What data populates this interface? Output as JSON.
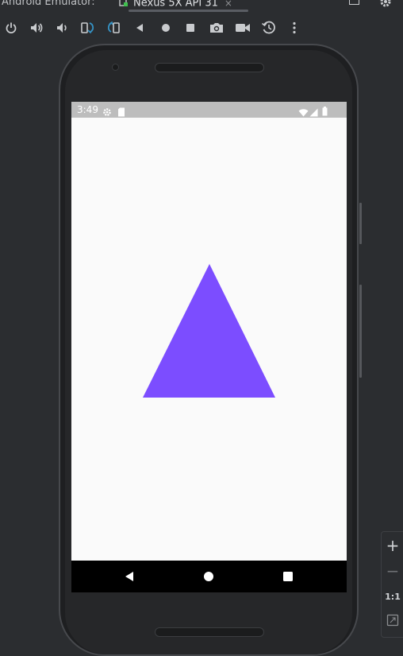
{
  "header": {
    "title": "Android Emulator:",
    "tab_label": "Nexus 5X API 31",
    "tab_close": "×"
  },
  "toolbar": {
    "buttons": [
      {
        "name": "power",
        "icon": "power-icon"
      },
      {
        "name": "volume-up",
        "icon": "volume-up-icon"
      },
      {
        "name": "volume-down",
        "icon": "volume-down-icon"
      },
      {
        "name": "rotate-left",
        "icon": "rotate-left-icon"
      },
      {
        "name": "rotate-right",
        "icon": "rotate-right-icon"
      },
      {
        "name": "back",
        "icon": "back-icon"
      },
      {
        "name": "home",
        "icon": "home-icon"
      },
      {
        "name": "overview",
        "icon": "overview-icon"
      },
      {
        "name": "screenshot",
        "icon": "camera-icon"
      },
      {
        "name": "screen-record",
        "icon": "video-camera-icon"
      },
      {
        "name": "snapshot",
        "icon": "snapshot-icon"
      },
      {
        "name": "more",
        "icon": "more-vertical-icon"
      }
    ]
  },
  "status_bar": {
    "time": "3:49",
    "background": "#bdbdbd"
  },
  "app": {
    "shape": "triangle",
    "shape_color": "#7c4dff",
    "background": "#fafafa"
  },
  "zoom_panel": {
    "zoom_in": "+",
    "zoom_out": "−",
    "actual_size": "1:1"
  },
  "colors": {
    "ide_background": "#2b2d30",
    "accent_blue": "#3592c4",
    "device_indicator": "#3fbf4f"
  }
}
